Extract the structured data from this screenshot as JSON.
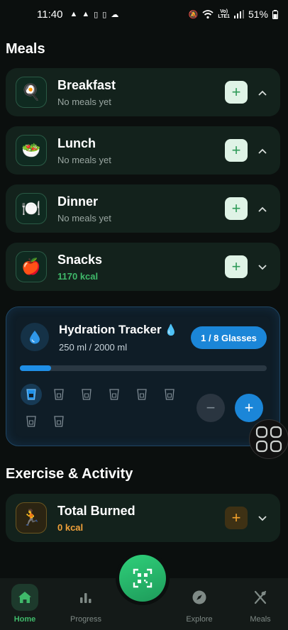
{
  "status_bar": {
    "time": "11:40",
    "battery": "51%"
  },
  "meals_title": "Meals",
  "meals": [
    {
      "name": "Breakfast",
      "sub": "No meals yet",
      "icon": "🍳",
      "chevron": "up"
    },
    {
      "name": "Lunch",
      "sub": "No meals yet",
      "icon": "🥗",
      "chevron": "up"
    },
    {
      "name": "Dinner",
      "sub": "No meals yet",
      "icon": "🍽️",
      "chevron": "up"
    },
    {
      "name": "Snacks",
      "sub": "1170 kcal",
      "icon": "🍎",
      "chevron": "down"
    }
  ],
  "hydration": {
    "title": "Hydration Tracker",
    "title_emoji": "💧",
    "amount": "250 ml / 2000 ml",
    "badge": "1 / 8 Glasses",
    "progress_fraction": 0.125,
    "glasses_filled": 1,
    "glasses_total": 8
  },
  "exercise_title": "Exercise & Activity",
  "exercise": {
    "name": "Total Burned",
    "sub": "0 kcal",
    "icon": "🏃"
  },
  "nav": {
    "home": "Home",
    "progress": "Progress",
    "explore": "Explore",
    "meals": "Meals"
  },
  "colors": {
    "accent_green": "#3fb96a",
    "accent_blue": "#1b86d8",
    "accent_orange": "#f2a12b",
    "background": "#0b0f0e"
  }
}
